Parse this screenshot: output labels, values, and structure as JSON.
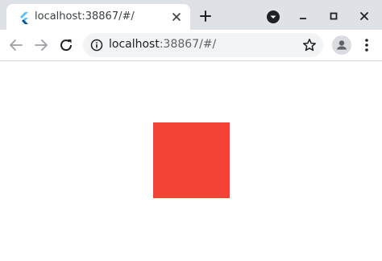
{
  "tab": {
    "title": "localhost:38867/#/",
    "favicon": "flutter-icon"
  },
  "toolbar": {
    "url_host": "localhost",
    "url_rest": ":38867/#/"
  },
  "icons": {
    "close": "close-icon",
    "new_tab": "plus-icon",
    "profile_menu": "chevron-down-icon",
    "minimize": "minimize-icon",
    "maximize": "maximize-icon",
    "window_close": "close-icon",
    "back": "back-arrow-icon",
    "forward": "forward-arrow-icon",
    "reload": "reload-icon",
    "info": "info-icon",
    "bookmark": "star-icon",
    "profile": "avatar-icon",
    "menu": "kebab-menu-icon"
  },
  "colors": {
    "tabstrip_bg": "#dee1e6",
    "omnibox_bg": "#f1f3f4",
    "square": "#f44336"
  }
}
